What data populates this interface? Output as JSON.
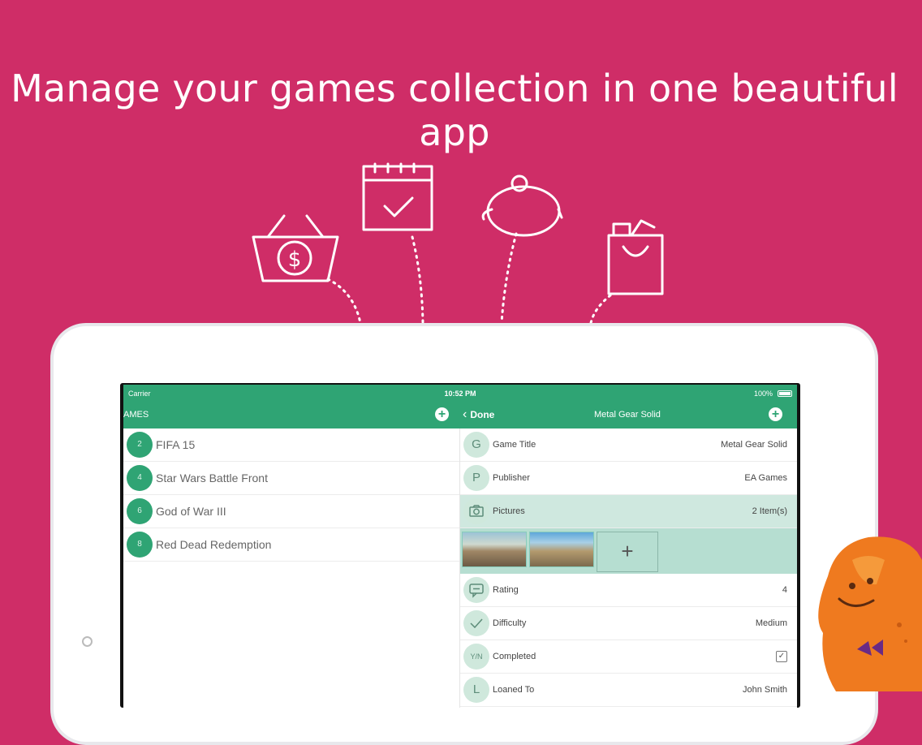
{
  "headline": "Manage your games collection in one beautiful app",
  "icons": [
    "shopping-basket-dollar-icon",
    "calendar-check-icon",
    "piggy-bank-icon",
    "shopping-bag-icon"
  ],
  "colors": {
    "background": "#cf2d67",
    "accent": "#2fa474",
    "highlight": "#cfe8df"
  },
  "status": {
    "carrier": "Carrier",
    "time": "10:52 PM",
    "battery": "100%"
  },
  "left_nav": {
    "title": "AMES",
    "add": "+"
  },
  "right_nav": {
    "back": "Done",
    "title": "Metal Gear Solid",
    "add": "+"
  },
  "games": [
    {
      "num": "2",
      "name": "FIFA 15"
    },
    {
      "num": "4",
      "name": "Star Wars Battle Front"
    },
    {
      "num": "6",
      "name": "God of War III"
    },
    {
      "num": "8",
      "name": "Red Dead Redemption"
    }
  ],
  "details": {
    "game_title": {
      "badge": "G",
      "label": "Game Title",
      "value": "Metal Gear Solid"
    },
    "publisher": {
      "badge": "P",
      "label": "Publisher",
      "value": "EA Games"
    },
    "pictures": {
      "label": "Pictures",
      "value": "2 Item(s)",
      "add": "+"
    },
    "rating": {
      "label": "Rating",
      "value": "4"
    },
    "difficulty": {
      "label": "Difficulty",
      "value": "Medium"
    },
    "completed": {
      "badge": "Y/N",
      "label": "Completed",
      "value": "✓"
    },
    "loaned": {
      "badge": "L",
      "label": "Loaned To",
      "value": "John Smith"
    }
  }
}
